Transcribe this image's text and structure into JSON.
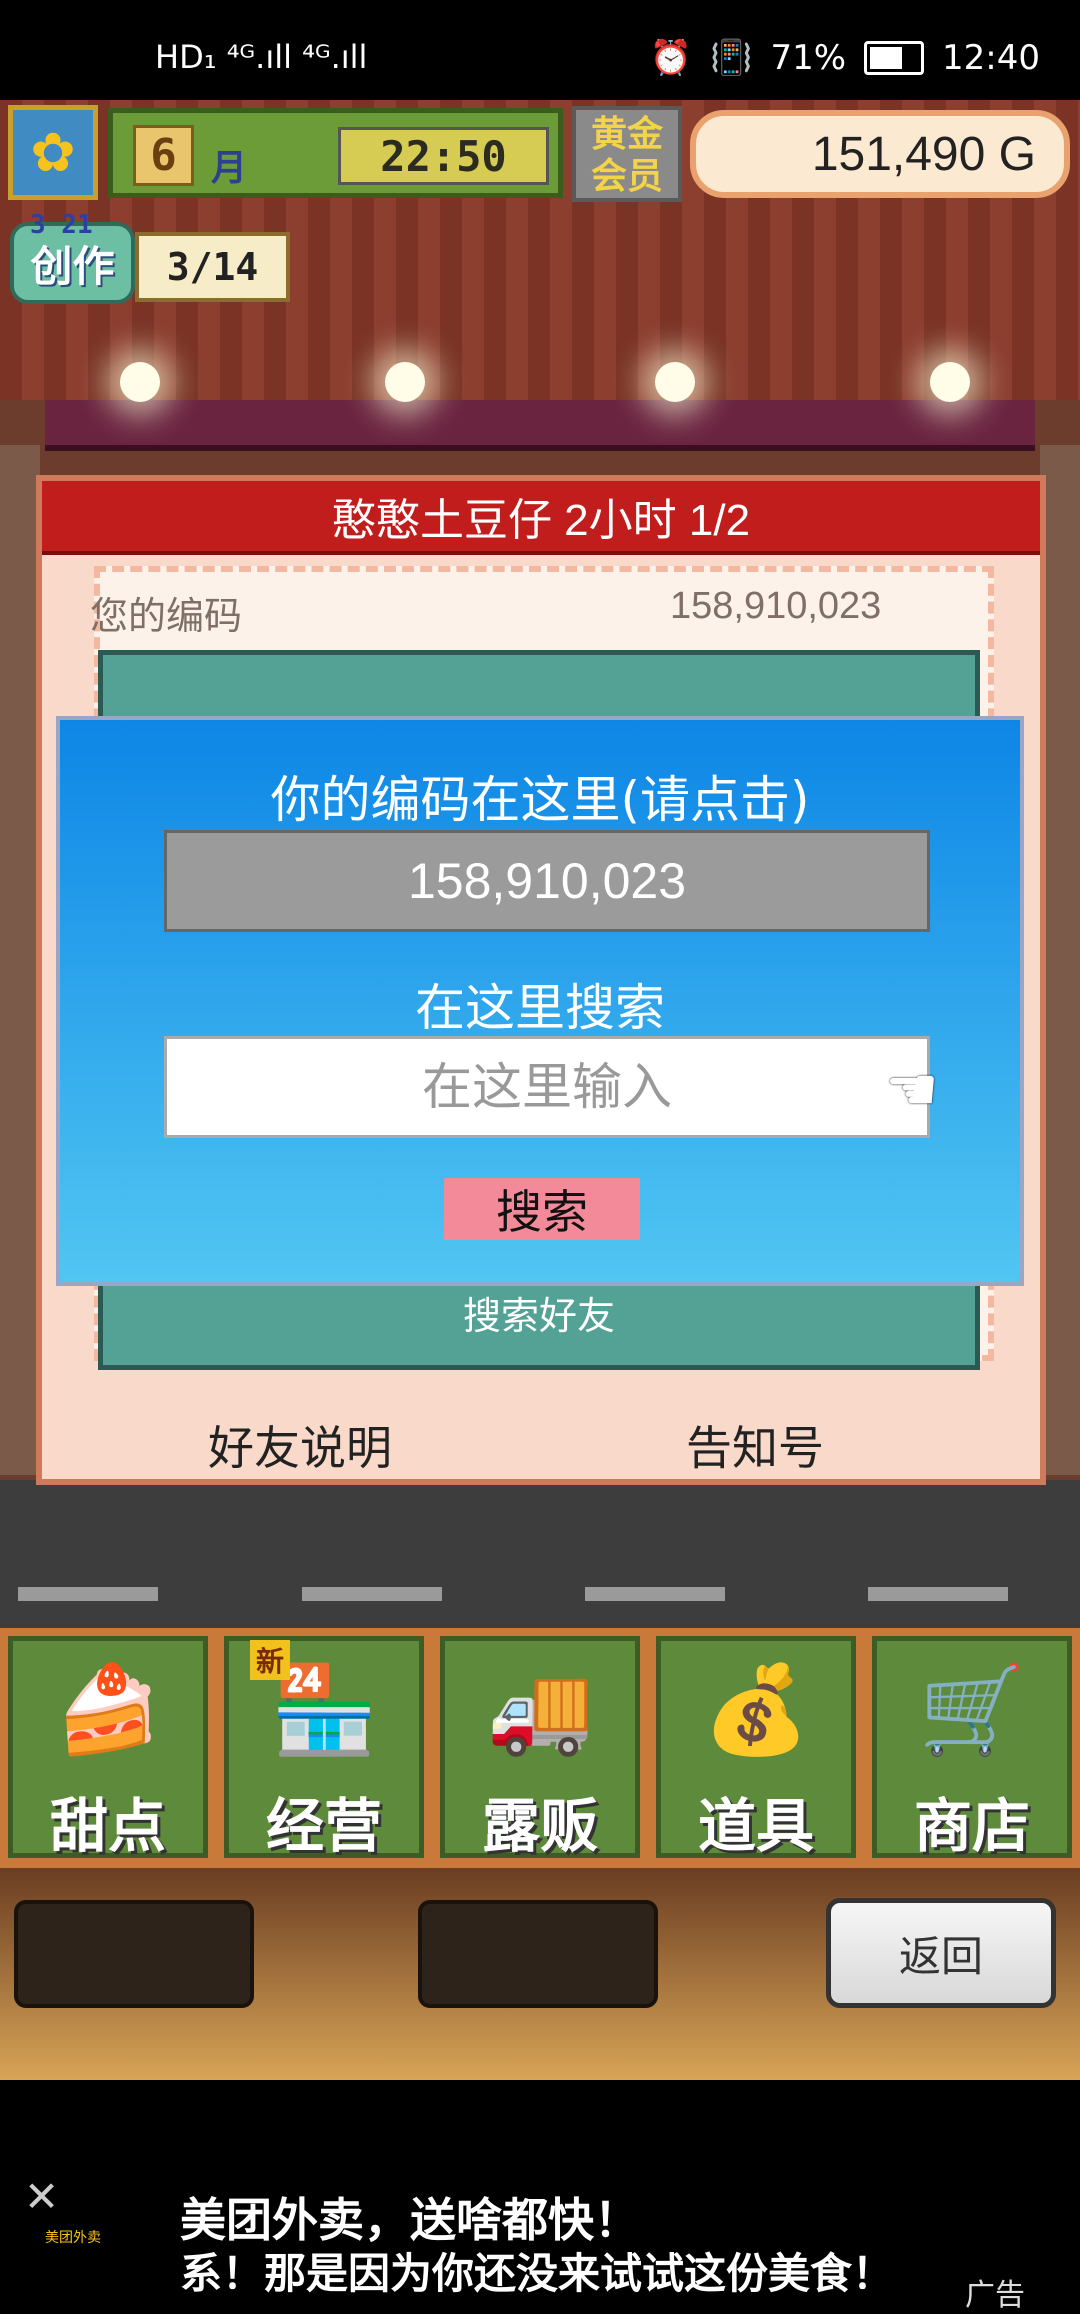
{
  "status_bar": {
    "network": "HD₁ ⁴ᴳ.ıll ⁴ᴳ.ıll",
    "battery_text": "71%",
    "battery_level": 0.71,
    "time": "12:40"
  },
  "hud": {
    "month_number": "6",
    "month_label": "月",
    "clock": "22:50",
    "membership": "黄金会员",
    "money": "151,490 G",
    "create_date": "3 21",
    "create_label": "创作",
    "create_progress": "3/14"
  },
  "dialog": {
    "title": "憨憨土豆仔  2小时 1/2",
    "your_code_label": "您的编码",
    "your_code_value": "158,910,023",
    "green_search_text": "搜索好友",
    "footer_left": "好友说明",
    "footer_right": "告知号"
  },
  "popup": {
    "title": "你的编码在这里(请点击)",
    "code_value": "158,910,023",
    "search_label": "在这里搜索",
    "search_placeholder": "在这里输入",
    "search_button": "搜索"
  },
  "menu": {
    "items": [
      {
        "label": "甜点",
        "icon": "cake-icon"
      },
      {
        "label": "经营",
        "icon": "shop-building-icon"
      },
      {
        "label": "露贩",
        "icon": "food-truck-icon"
      },
      {
        "label": "道具",
        "icon": "items-bag-icon"
      },
      {
        "label": "商店",
        "icon": "shopping-cart-icon"
      }
    ],
    "new_tag": "新",
    "back_button": "返回"
  },
  "ad": {
    "close": "✕",
    "brand": "美团外卖",
    "line1": "美团外卖，送啥都快！",
    "line2": "系！那是因为你还没来试试这份美食！",
    "tag": "广告"
  }
}
